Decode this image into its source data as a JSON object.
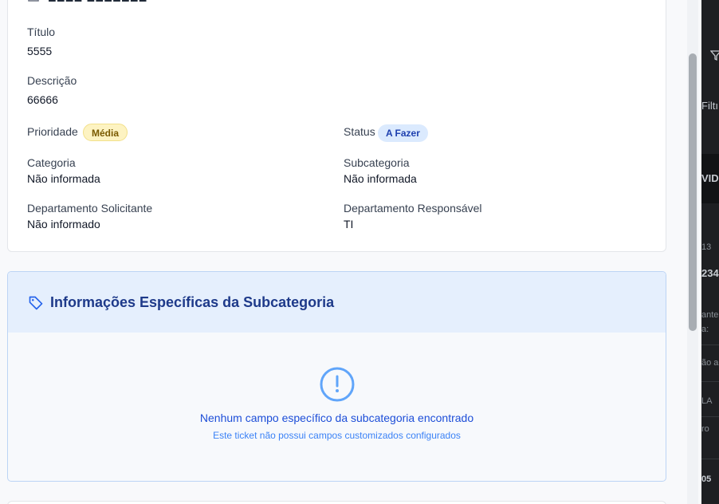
{
  "details": {
    "title_label": "Título",
    "title_value": "5555",
    "description_label": "Descrição",
    "description_value": "66666",
    "priority_label": "Prioridade",
    "priority_badge": "Média",
    "status_label": "Status",
    "status_badge": "A Fazer",
    "category_label": "Categoria",
    "category_value": "Não informada",
    "subcategory_label": "Subcategoria",
    "subcategory_value": "Não informada",
    "requesting_dept_label": "Departamento Solicitante",
    "requesting_dept_value": "Não informado",
    "responsible_dept_label": "Departamento Responsável",
    "responsible_dept_value": "TI"
  },
  "subcategory_section": {
    "title": "Informações Específicas da Subcategoria",
    "icon": "tag-icon",
    "empty_icon": "alert-circle-icon",
    "empty_title": "Nenhum campo específico da subcategoria encontrado",
    "empty_subtitle": "Este ticket não possui campos customizados configurados"
  },
  "background_fragments": {
    "filter_label": "Filtı",
    "header_text": "VID",
    "number_a": "13",
    "number_b": "234",
    "text_a": "ante",
    "text_b": "a:",
    "text_c": "ão a",
    "text_d": "LA",
    "text_e": "ro",
    "number_c": "05"
  },
  "colors": {
    "accent": "#1d4ed8",
    "medium_badge_bg": "#fdf3c2",
    "status_badge_bg": "#dbeafe",
    "section_header_bg": "#e5effd"
  }
}
